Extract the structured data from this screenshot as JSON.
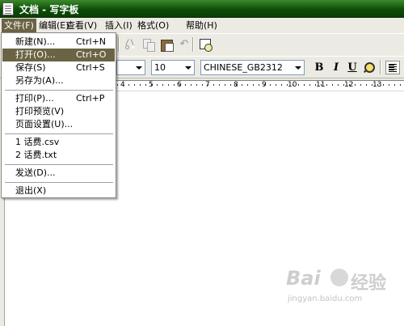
{
  "window": {
    "title": "文档 - 写字板"
  },
  "menubar": [
    {
      "label": "文件(F)"
    },
    {
      "label": "编辑(E)"
    },
    {
      "label": "查看(V)"
    },
    {
      "label": "插入(I)"
    },
    {
      "label": "格式(O)"
    },
    {
      "label": "帮助(H)"
    }
  ],
  "file_menu": {
    "items": [
      {
        "label": "新建(N)...",
        "shortcut": "Ctrl+N"
      },
      {
        "label": "打开(O)...",
        "shortcut": "Ctrl+O",
        "highlighted": true
      },
      {
        "label": "保存(S)",
        "shortcut": "Ctrl+S"
      },
      {
        "label": "另存为(A)...",
        "shortcut": ""
      },
      {
        "label": "打印(P)...",
        "shortcut": "Ctrl+P"
      },
      {
        "label": "打印预览(V)",
        "shortcut": ""
      },
      {
        "label": "页面设置(U)...",
        "shortcut": ""
      },
      {
        "label": "1 话费.csv",
        "shortcut": ""
      },
      {
        "label": "2 话费.txt",
        "shortcut": ""
      },
      {
        "label": "发送(D)...",
        "shortcut": ""
      },
      {
        "label": "退出(X)",
        "shortcut": ""
      }
    ]
  },
  "toolbar": {
    "icons": [
      "cut-icon",
      "copy-icon",
      "paste-icon",
      "undo-icon",
      "date-time-icon"
    ],
    "undo_glyph": "↶"
  },
  "format_bar": {
    "font_size": "10",
    "script": "CHINESE_GB2312",
    "bold": "B",
    "italic": "I",
    "underline": "U"
  },
  "ruler": {
    "labels": [
      "4",
      "5",
      "6",
      "7",
      "8",
      "9",
      "10",
      "11",
      "12",
      "13"
    ]
  },
  "watermark": {
    "logo_left": "Bai",
    "logo_right": "经验",
    "url": "jingyan.baidu.com"
  },
  "colors": {
    "titlebar": "#0c4e06",
    "menu_highlight": "#6b6444",
    "chrome": "#ecebe3"
  }
}
